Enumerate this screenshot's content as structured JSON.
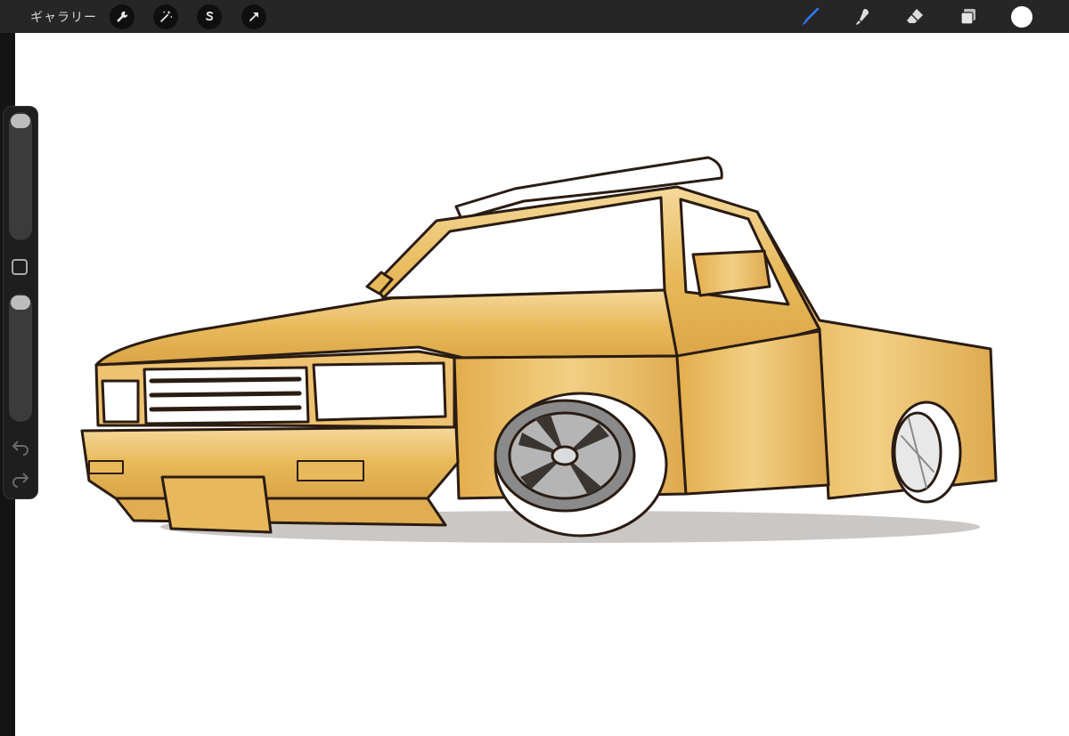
{
  "toolbar": {
    "gallery_label": "ギャラリー",
    "actions": [
      {
        "icon": "wrench-icon"
      },
      {
        "icon": "magic-wand-icon"
      },
      {
        "icon": "selection-s-icon"
      },
      {
        "icon": "transform-arrow-icon"
      }
    ],
    "tools": [
      {
        "icon": "brush-icon",
        "active": true
      },
      {
        "icon": "smudge-icon",
        "active": false
      },
      {
        "icon": "eraser-icon",
        "active": false
      },
      {
        "icon": "layers-icon",
        "active": false
      }
    ],
    "current_color": "#ffffff",
    "accent": "#2f7bff"
  },
  "sidebar": {
    "brush_size": 0.95,
    "opacity": 0.95
  },
  "canvas": {
    "background": "#ffffff",
    "subject": "truck-illustration",
    "body_color": "#e8b95a",
    "outline_color": "#2a1c12"
  }
}
